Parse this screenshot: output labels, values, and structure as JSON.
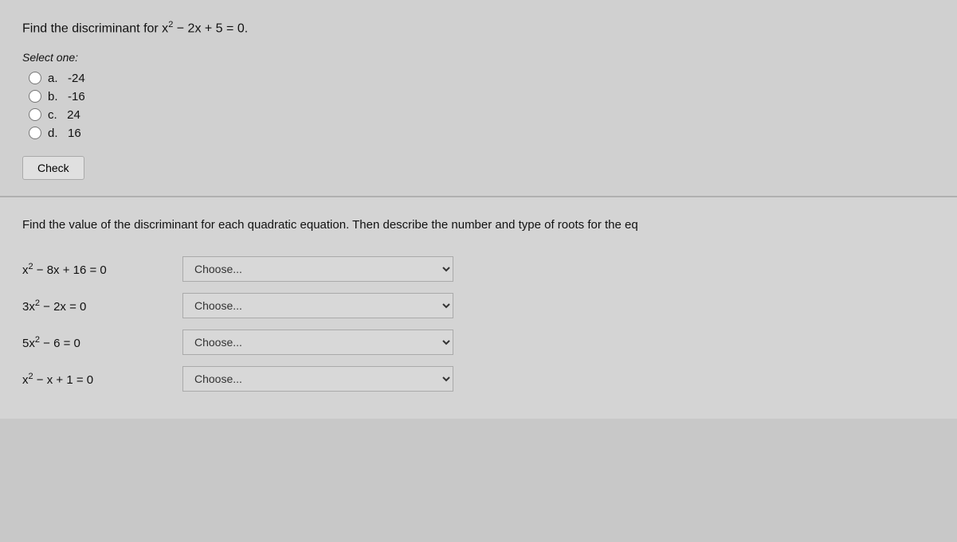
{
  "section1": {
    "question": "Find the discriminant for x² − 2x + 5 = 0.",
    "select_one": "Select one:",
    "options": [
      {
        "id": "a",
        "label": "a.",
        "value": "-24"
      },
      {
        "id": "b",
        "label": "b.",
        "value": "-16"
      },
      {
        "id": "c",
        "label": "c.",
        "value": "24"
      },
      {
        "id": "d",
        "label": "d.",
        "value": "16"
      }
    ],
    "check_button": "Check"
  },
  "section2": {
    "title": "Find the value of the discriminant for each quadratic equation. Then describe the number and type of roots for the eq",
    "equations": [
      {
        "label": "x² − 8x + 16 = 0",
        "placeholder": "Choose..."
      },
      {
        "label": "3x² − 2x = 0",
        "placeholder": "Choose..."
      },
      {
        "label": "5x² − 6 = 0",
        "placeholder": "Choose..."
      },
      {
        "label": "x² − x + 1 = 0",
        "placeholder": "Choose..."
      }
    ]
  }
}
